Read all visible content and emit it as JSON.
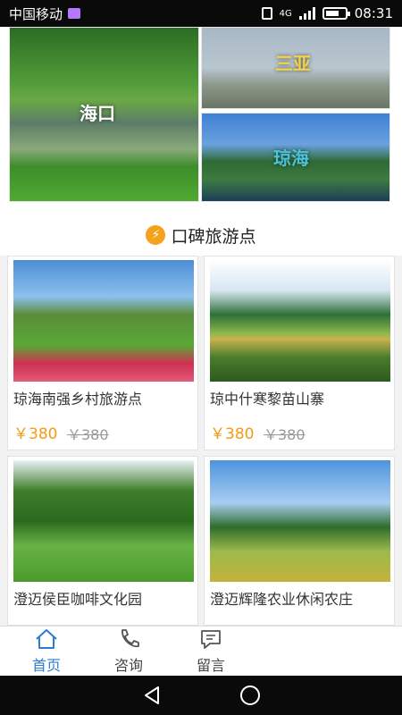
{
  "status": {
    "carrier": "中国移动",
    "network": "4G",
    "time": "08:31"
  },
  "banner": {
    "tiles": [
      {
        "label": "海口"
      },
      {
        "label": "三亚"
      },
      {
        "label": "琼海"
      }
    ]
  },
  "section": {
    "title": "口碑旅游点",
    "icon": "lightning-icon"
  },
  "spots": [
    {
      "name": "琼海南强乡村旅游点",
      "price": "￥380",
      "old_price": "￥380"
    },
    {
      "name": "琼中什寒黎苗山寨",
      "price": "￥380",
      "old_price": "￥380"
    },
    {
      "name": "澄迈侯臣咖啡文化园",
      "price": "",
      "old_price": ""
    },
    {
      "name": "澄迈辉隆农业休闲农庄",
      "price": "",
      "old_price": ""
    }
  ],
  "tabs": [
    {
      "label": "首页",
      "icon": "home-icon",
      "active": true
    },
    {
      "label": "咨询",
      "icon": "phone-icon",
      "active": false
    },
    {
      "label": "留言",
      "icon": "message-icon",
      "active": false
    }
  ],
  "colors": {
    "accent": "#2b7cd3",
    "price": "#f39c12",
    "section_icon": "#f4a21b"
  }
}
